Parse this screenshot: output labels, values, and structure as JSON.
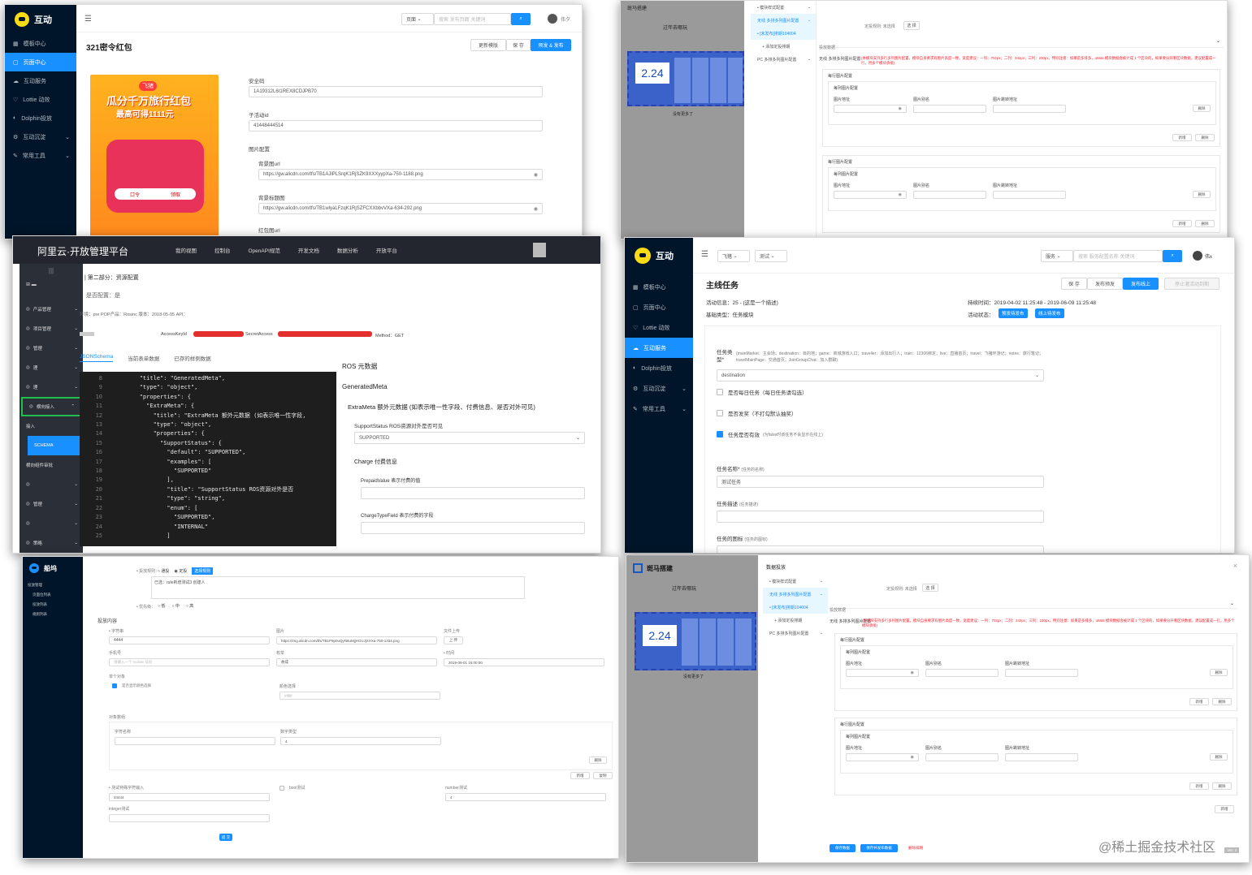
{
  "panel1": {
    "logo": "互动",
    "nav": [
      {
        "label": "模板中心",
        "icon": "grid-icon"
      },
      {
        "label": "页面中心",
        "icon": "page-icon"
      },
      {
        "label": "互动服务",
        "icon": "cloud-icon"
      },
      {
        "label": "Lottie 动效",
        "icon": "heart-icon"
      },
      {
        "label": "Dolphin投放",
        "icon": "dolphin-icon"
      },
      {
        "label": "互动沉淀",
        "icon": "settings-icon"
      },
      {
        "label": "常用工具",
        "icon": "tool-icon"
      }
    ],
    "search_scope": "页面",
    "search_placeholder": "搜索 发布页面 关键词",
    "user": "伟夕",
    "title": "321密令红包",
    "actions": [
      "更新模版",
      "保 存",
      "预发 & 发布"
    ],
    "poster": {
      "brand": "飞猪",
      "headline1": "瓜分千万旅行红包",
      "headline2": "最高可得1111元",
      "code_label": "口令",
      "tag": "领取"
    },
    "fields": [
      {
        "label": "安全码",
        "value": "1A19312L6I1REX8CDJPB70"
      },
      {
        "label": "子活动id",
        "value": "41448444514"
      },
      {
        "label": "图片配置",
        "value": ""
      },
      {
        "label": "背景图url",
        "value": "https://gw.alicdn.com/tfs/TB1AJlPLSrqK1RjSZK9XXXyypXa-750-1188.png"
      },
      {
        "label": "背景标题图",
        "value": "https://gw.alicdn.com/tfs/TB1wlyaLFzqK1RjSZFCXXbbvVXa-634-292.png"
      },
      {
        "label": "红包图url",
        "value": ""
      }
    ]
  },
  "panel2": {
    "left_header": "斑马搭建",
    "phone_title": "过年去哪玩",
    "price": "2.24",
    "more": "没有更多了",
    "tree": [
      {
        "label": "• 模块样式配置",
        "sel": false
      },
      {
        "label": "无线 多排多列图片配置",
        "sel": true
      },
      {
        "label": "• [未发布]排期104004",
        "sel": true
      },
      {
        "label": "+ 添加定投排期",
        "sel": false
      },
      {
        "label": "PC 多排多列图片配置",
        "sel": false
      }
    ],
    "rule_label": "定投规则:",
    "rule_value": "未选择",
    "select_btn": "选 择",
    "section": "投放数据",
    "module": "无线 多排多列图片配置",
    "warn": "(本模块支持多行多列图片配置，模块自身要求有图片高度一致，宽度建议：一列：702px；二列：342px；三列：230px，特别注意：如果是多排多，u8ata 模块数据会被计成 1 个区块的，如果要分开看区块数据，建议配置成一行，用多个模块承接)",
    "row_title": "每行图片配置",
    "col_title": "每列图片配置",
    "cols": [
      "图片地址",
      "图片别名",
      "图片跳转地址"
    ],
    "del": "删除",
    "add": "新增"
  },
  "panel3": {
    "title": "阿里云·开放管理平台",
    "topnav": [
      "我的视图",
      "控制台",
      "OpenAPI规范",
      "开发文档",
      "数据分析",
      "开放平台"
    ],
    "side": [
      "产品管理",
      "项目管理",
      "管理",
      "理",
      "理",
      "横向接入",
      "接入",
      "SCHEMA",
      "横向组件审批",
      "",
      "管理",
      "",
      "策略"
    ],
    "breadcrumb": "第二部分：资源配置",
    "subtitle": "是否配置：是",
    "env": "环境：pre  POP产品：Rosinc  版本：2018-05-05  API：",
    "keys": "AccessKeyId",
    "secret": "SecretAccess",
    "method": "Method：GET",
    "tabs": [
      "JSONSchema",
      "当前表单数据",
      "已存的样例数据"
    ],
    "code": [
      {
        "n": "8",
        "t": "        \"title\": \"GeneratedMeta\","
      },
      {
        "n": "9",
        "t": "        \"type\": \"object\","
      },
      {
        "n": "10",
        "t": "        \"properties\": {"
      },
      {
        "n": "11",
        "t": "          \"ExtraMeta\": {"
      },
      {
        "n": "12",
        "t": "            \"title\": \"ExtraMeta 额外元数据 (如表示唯一性字段,"
      },
      {
        "n": "13",
        "t": "            \"type\": \"object\","
      },
      {
        "n": "14",
        "t": "            \"properties\": {"
      },
      {
        "n": "15",
        "t": "              \"SupportStatus\": {"
      },
      {
        "n": "16",
        "t": "                \"default\": \"SUPPORTED\","
      },
      {
        "n": "17",
        "t": "                \"examples\": ["
      },
      {
        "n": "18",
        "t": "                  \"SUPPORTED\""
      },
      {
        "n": "19",
        "t": "                ],"
      },
      {
        "n": "20",
        "t": "                \"title\": \"SupportStatus ROS资源对外是否"
      },
      {
        "n": "21",
        "t": "                \"type\": \"string\","
      },
      {
        "n": "22",
        "t": "                \"enum\": ["
      },
      {
        "n": "23",
        "t": "                  \"SUPPORTED\","
      },
      {
        "n": "24",
        "t": "                  \"INTERNAL\""
      },
      {
        "n": "25",
        "t": "                ]"
      }
    ],
    "form": {
      "h1": "ROS 元数据",
      "h2": "GeneratedMeta",
      "h3": "ExtraMeta 额外元数据 (如表示唯一性字段、付费信息、是否对外可见)",
      "support_label": "SupportStatus ROS资源对外是否可见",
      "support_value": "SUPPORTED",
      "charge": "Charge 付费信息",
      "prepaid": "PrepaidValue 表示付费的值",
      "chargetype": "ChargeTypeField 表示付费的字段"
    }
  },
  "panel4": {
    "logo": "互动",
    "nav": [
      {
        "label": "模板中心",
        "icon": "grid-icon"
      },
      {
        "label": "页面中心",
        "icon": "page-icon"
      },
      {
        "label": "Lottie 动效",
        "icon": "heart-icon"
      },
      {
        "label": "互动服务",
        "icon": "cloud-icon"
      },
      {
        "label": "Dolphin投放",
        "icon": "dolphin-icon"
      },
      {
        "label": "互动沉淀",
        "icon": "settings-icon"
      },
      {
        "label": "常用工具",
        "icon": "tool-icon"
      }
    ],
    "filter1": "飞猪",
    "filter2": "测试",
    "search_scope": "服务",
    "search_placeholder": "搜索 服务配置名称 关键词",
    "user": "伟x",
    "title": "主线任务",
    "actions": [
      "保 存",
      "发布预发",
      "发布线上",
      "停止灌活动到期"
    ],
    "info": "活动信息：25 - (这是一个描述)",
    "base": "基础类型：任务模块",
    "duration": "持续时间：2019-04-02 11:25:48 - 2019-06-09 11:25:48",
    "status": "活动状态：",
    "status_tags": [
      "预发待发布",
      "线上待发布"
    ],
    "task_label": "任务类型*",
    "task_hint": "(mainMarket：主会场；destination：目的地；game：商城游戏入口；traveller：添加出行人；train：12306绑定；live：直播首页；travel：飞猪环游记；notes：旅行笔记；travelMainPage：交通首页；JoinGroupChat：加入群聊)",
    "task_value": "destination",
    "checks": [
      {
        "label": "是否每日任务（每日任务请勾选）",
        "on": false
      },
      {
        "label": "是否发奖（不打勾默认抽奖）",
        "on": false
      },
      {
        "label": "任务是否有效",
        "hint": "(为false时该任务不会显示在线上)",
        "on": true
      }
    ],
    "name_label": "任务名称*",
    "name_hint": "(任务的名称)",
    "name_value": "测试任务",
    "desc_label": "任务描述",
    "desc_hint": "(任务描述)",
    "icon_label": "任务的图标",
    "icon_hint": "(任务的图标)"
  },
  "panel5": {
    "logo": "船坞",
    "menu": [
      "投放管理",
      "页面位列表",
      "投放列表",
      "规则列表"
    ],
    "rule_label": "• 投放规则：",
    "rule_opts": [
      "通投",
      "定投",
      "选择规则"
    ],
    "rule_text": "已选：rule新增测试3  创建人",
    "priority": "• 优先级：",
    "prio_opts": [
      "低",
      "中",
      "高"
    ],
    "section": "投放内容",
    "f_string": "• 字符串",
    "f_string_val": "4444",
    "f_image": "图片",
    "f_image_val": "https://img.alicdn.com/tfs/TB1P9p0uQyN8uMjjHCUJjXXXa-750-1334.png",
    "f_file": "文件上传",
    "f_upload": "上 传",
    "f_mobile": "手机号",
    "f_mobile_ph": "请输入一个 mobile 号码",
    "f_enum": "枚举",
    "f_enum_val": "枚成",
    "f_time": "• 时间",
    "f_time_val": "2019-09-01 16:00:00",
    "f_obj": "单个对象",
    "f_color_check": "是否显示颜色选择",
    "f_color": "颜色选择",
    "f_color_ph": "#ffffff",
    "f_arr": "对象数组",
    "f_name": "字符名称",
    "f_num": "数字类型",
    "f_num_val": "4",
    "f_del": "删除",
    "f_add": "新增",
    "f_copy": "复制",
    "f_test": "• 测试特殊字符输入",
    "f_test_val": "44444",
    "f_bool": "bool测试",
    "f_number": "number测试",
    "f_number_val": "4",
    "f_integer": "integer测试",
    "submit": "提 交"
  },
  "panel6": {
    "header": "斑马搭建",
    "dialog": "数据投放",
    "phone_title": "过年去哪玩",
    "price": "2.24",
    "more": "没有更多了",
    "footer_btns": [
      "保存数据",
      "保存并发布数据",
      "删除排期"
    ],
    "page": "Ver: 2"
  },
  "watermark": "@稀土掘金技术社区"
}
